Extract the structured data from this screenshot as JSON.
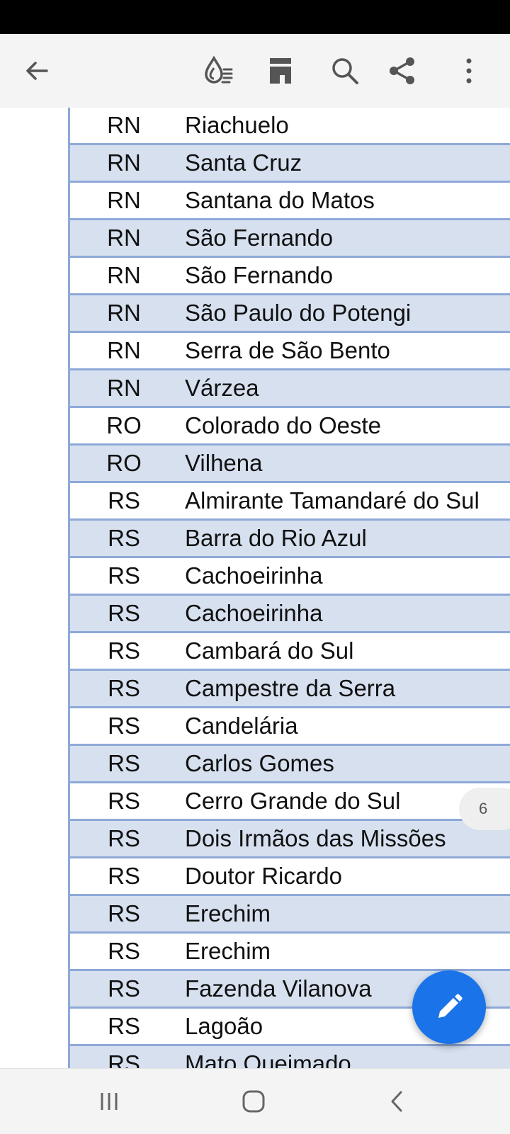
{
  "toolbar": {
    "icons": [
      "back-arrow-icon",
      "reading-mode-icon",
      "page-layout-icon",
      "search-icon",
      "share-icon",
      "more-options-icon"
    ]
  },
  "table": {
    "rows": [
      {
        "uf": "RN",
        "city": "Riachuelo"
      },
      {
        "uf": "RN",
        "city": "Santa Cruz"
      },
      {
        "uf": "RN",
        "city": "Santana do Matos"
      },
      {
        "uf": "RN",
        "city": "São Fernando"
      },
      {
        "uf": "RN",
        "city": "São Fernando"
      },
      {
        "uf": "RN",
        "city": "São Paulo do Potengi"
      },
      {
        "uf": "RN",
        "city": "Serra de São Bento"
      },
      {
        "uf": "RN",
        "city": "Várzea"
      },
      {
        "uf": "RO",
        "city": "Colorado do Oeste"
      },
      {
        "uf": "RO",
        "city": "Vilhena"
      },
      {
        "uf": "RS",
        "city": "Almirante Tamandaré do Sul"
      },
      {
        "uf": "RS",
        "city": "Barra do Rio Azul"
      },
      {
        "uf": "RS",
        "city": "Cachoeirinha"
      },
      {
        "uf": "RS",
        "city": "Cachoeirinha"
      },
      {
        "uf": "RS",
        "city": "Cambará do Sul"
      },
      {
        "uf": "RS",
        "city": "Campestre da Serra"
      },
      {
        "uf": "RS",
        "city": "Candelária"
      },
      {
        "uf": "RS",
        "city": "Carlos Gomes"
      },
      {
        "uf": "RS",
        "city": "Cerro Grande do Sul"
      },
      {
        "uf": "RS",
        "city": "Dois Irmãos das Missões"
      },
      {
        "uf": "RS",
        "city": "Doutor Ricardo"
      },
      {
        "uf": "RS",
        "city": "Erechim"
      },
      {
        "uf": "RS",
        "city": "Erechim"
      },
      {
        "uf": "RS",
        "city": "Fazenda Vilanova"
      },
      {
        "uf": "RS",
        "city": "Lagoão"
      },
      {
        "uf": "RS",
        "city": "Mato Queimado"
      }
    ]
  },
  "page_indicator": "6",
  "fab": {
    "icon": "edit-pencil-icon"
  },
  "navbar": {
    "icons": [
      "recent-apps-icon",
      "home-icon",
      "back-icon"
    ]
  },
  "colors": {
    "row_alt": "#d6e0ef",
    "grid": "#8ea9d8",
    "fab": "#1a73e8"
  }
}
